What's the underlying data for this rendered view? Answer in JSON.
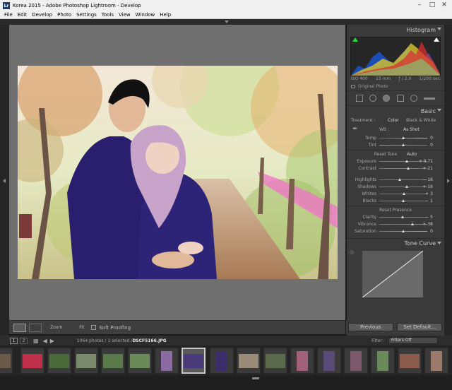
{
  "window": {
    "title": "Korea 2015 - Adobe Photoshop Lightroom - Develop",
    "icon": "Lr"
  },
  "menu": [
    "File",
    "Edit",
    "Develop",
    "Photo",
    "Settings",
    "Tools",
    "View",
    "Window",
    "Help"
  ],
  "toolbar": {
    "zoom_label": "Zoom",
    "fit_label": "Fit",
    "soft_proofing": "Soft Proofing"
  },
  "histogram": {
    "title": "Histogram",
    "iso": "ISO 400",
    "focal": "23 mm",
    "aperture": "ƒ / 2.0",
    "shutter": "1/200 sec",
    "original_photo": "Original Photo"
  },
  "basic": {
    "title": "Basic",
    "treatment_label": "Treatment :",
    "color": "Color",
    "bw": "Black & White",
    "wb_label": "WB :",
    "wb_value": "As Shot",
    "temp": {
      "label": "Temp",
      "value": "0",
      "position": 0.5
    },
    "tint": {
      "label": "Tint",
      "value": "0",
      "position": 0.5
    },
    "reset_tone": "Reset Tone",
    "auto": "Auto",
    "exposure": {
      "label": "Exposure",
      "value": "+ 0.71",
      "position": 0.57
    },
    "contrast": {
      "label": "Contrast",
      "value": "+ 21",
      "position": 0.6
    },
    "highlights": {
      "label": "Highlights",
      "value": "− 16",
      "position": 0.42
    },
    "shadows": {
      "label": "Shadows",
      "value": "+ 16",
      "position": 0.58
    },
    "whites": {
      "label": "Whites",
      "value": "+ 3",
      "position": 0.52
    },
    "blacks": {
      "label": "Blacks",
      "value": "− 1",
      "position": 0.5
    },
    "reset_presence": "Reset Presence",
    "clarity": {
      "label": "Clarity",
      "value": "− 5",
      "position": 0.48
    },
    "vibrance": {
      "label": "Vibrance",
      "value": "+ 38",
      "position": 0.69
    },
    "saturation": {
      "label": "Saturation",
      "value": "0",
      "position": 0.5
    }
  },
  "tone_curve": {
    "title": "Tone Curve"
  },
  "buttons": {
    "previous": "Previous",
    "set_default": "Set Default..."
  },
  "filmstrip": {
    "page1": "1",
    "page2": "2",
    "info": "1064 photos / 1 selected / ",
    "filename": "DSCF5166.JPG",
    "filter_label": "Filter :",
    "filter_value": "Filters Off"
  },
  "colors": {
    "panel": "#3a3a3a",
    "accent_purple": "#2a1f6e",
    "pink": "#c8a3c9"
  }
}
